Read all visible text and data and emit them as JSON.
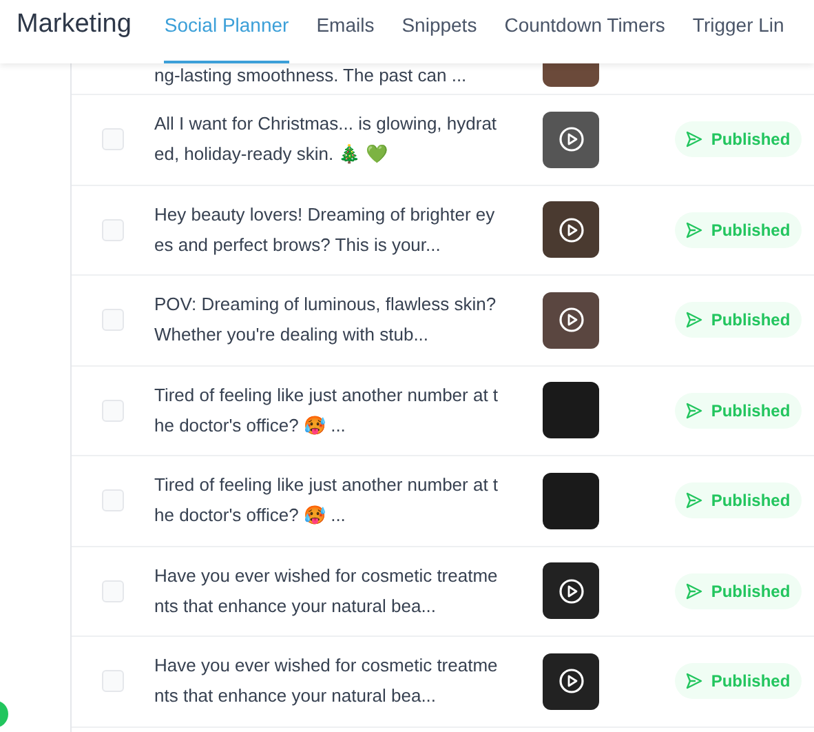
{
  "header": {
    "title": "Marketing",
    "tabs": [
      {
        "label": "Social Planner",
        "selected": true
      },
      {
        "label": "Emails",
        "selected": false
      },
      {
        "label": "Snippets",
        "selected": false
      },
      {
        "label": "Countdown Timers",
        "selected": false
      },
      {
        "label": "Trigger Lin",
        "selected": false
      }
    ]
  },
  "clipped_post": {
    "text": "ng-lasting smoothness. The past can ..."
  },
  "posts": [
    {
      "text": "All I want for Christmas... is glowing, hydrated, holiday-ready skin. 🎄 💚",
      "checked": false,
      "video": true,
      "status": "Published"
    },
    {
      "text": "Hey beauty lovers! Dreaming of brighter eyes and perfect brows? This is your...",
      "checked": false,
      "video": true,
      "status": "Published"
    },
    {
      "text": "POV: Dreaming of luminous, flawless skin? Whether you're dealing with stub...",
      "checked": false,
      "video": true,
      "status": "Published"
    },
    {
      "text": "Tired of feeling like just another number at the doctor's office? 🥵 ...",
      "checked": false,
      "video": false,
      "status": "Published"
    },
    {
      "text": "Tired of feeling like just another number at the doctor's office? 🥵 ...",
      "checked": false,
      "video": false,
      "status": "Published"
    },
    {
      "text": "Have you ever wished for cosmetic treatments that enhance your natural bea...",
      "checked": false,
      "video": true,
      "status": "Published"
    },
    {
      "text": "Have you ever wished for cosmetic treatments that enhance your natural bea...",
      "checked": false,
      "video": true,
      "status": "Published"
    }
  ]
}
